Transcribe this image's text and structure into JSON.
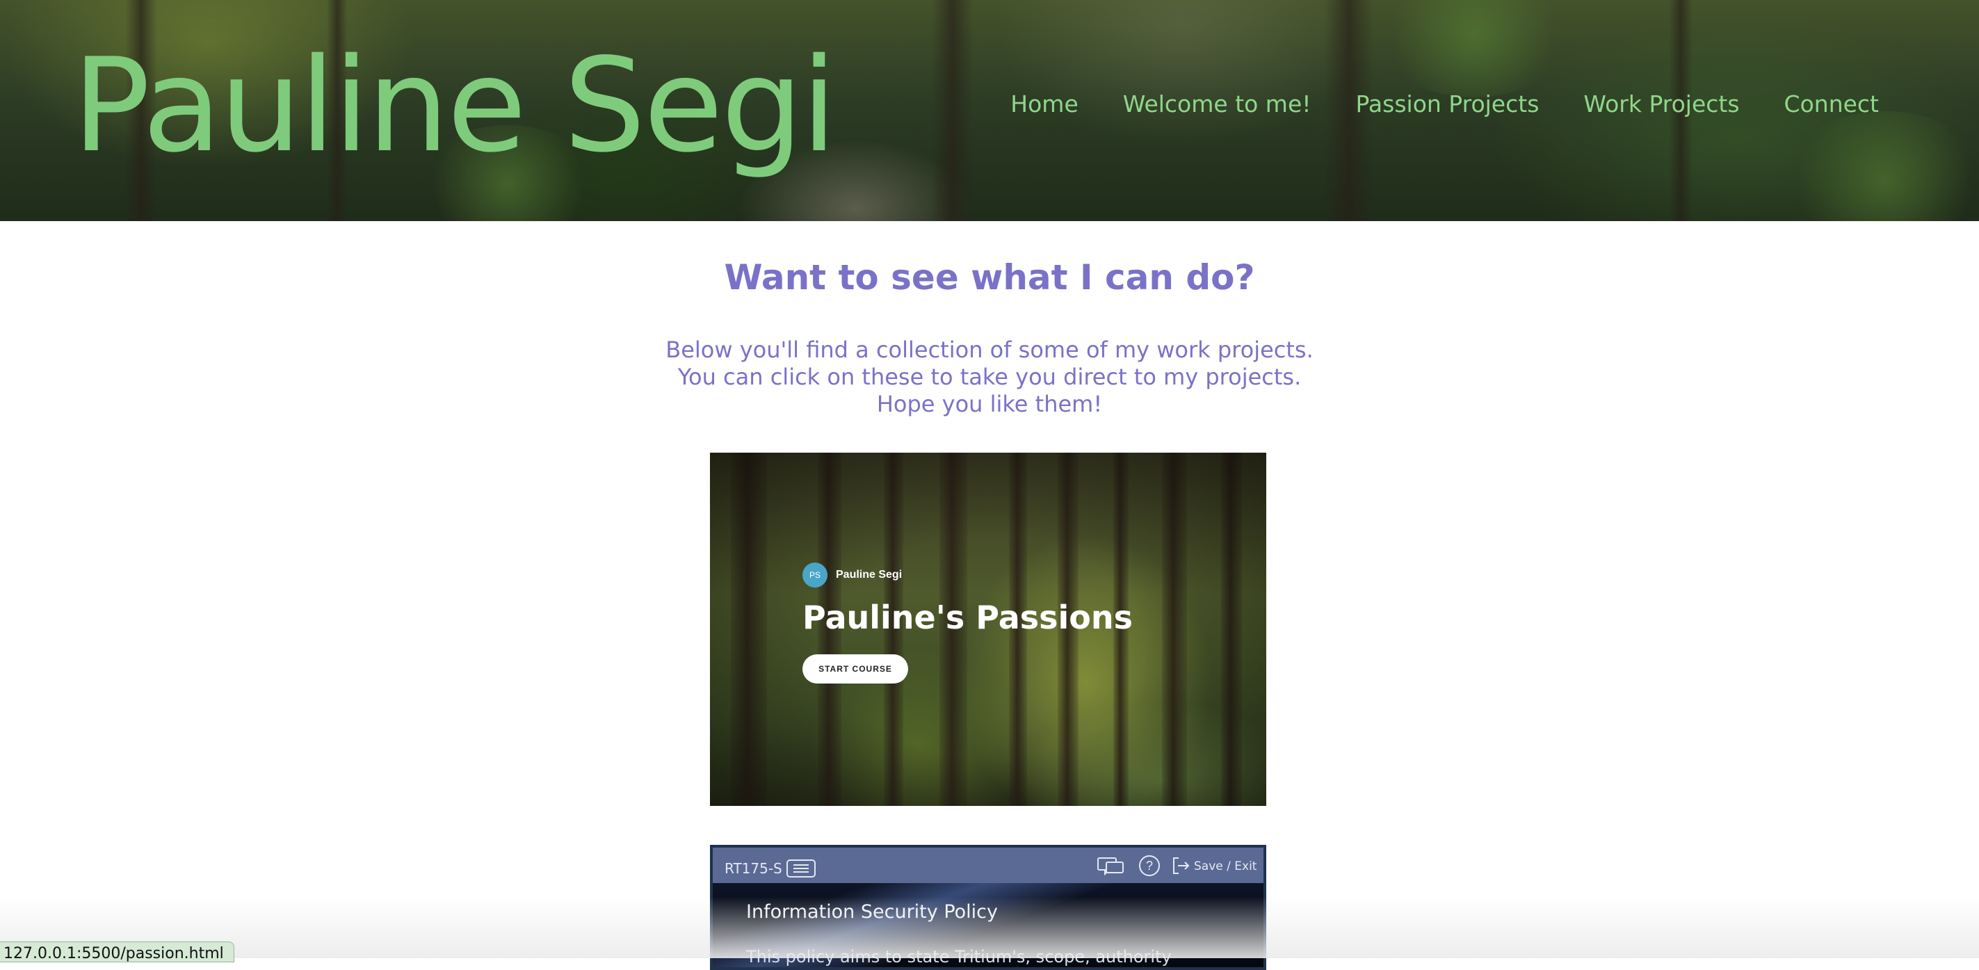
{
  "header": {
    "site_title": "Pauline Segi",
    "nav": [
      "Home",
      "Welcome to me!",
      "Passion Projects",
      "Work Projects",
      "Connect"
    ]
  },
  "main": {
    "heading": "Want to see what I can do?",
    "intro_lines": [
      "Below you'll find a collection of some of my work projects.",
      "You can click on these to take you direct to my projects.",
      "Hope you like them!"
    ]
  },
  "project_1": {
    "avatar_initials": "PS",
    "author": "Pauline Segi",
    "title": "Pauline's Passions",
    "button": "START COURSE"
  },
  "project_2": {
    "code": "RT175-S",
    "save_exit": "Save / Exit",
    "help_glyph": "?",
    "title": "Information Security Policy",
    "text": "This policy aims to state Tritium's, scope, authority"
  },
  "status_bar": {
    "url": "127.0.0.1:5500/passion.html"
  },
  "colors": {
    "title_green": "#7fcb7c",
    "nav_green": "#8fd78a",
    "accent_purple": "#7a72c8",
    "topbar_blue": "#5a6a95"
  }
}
